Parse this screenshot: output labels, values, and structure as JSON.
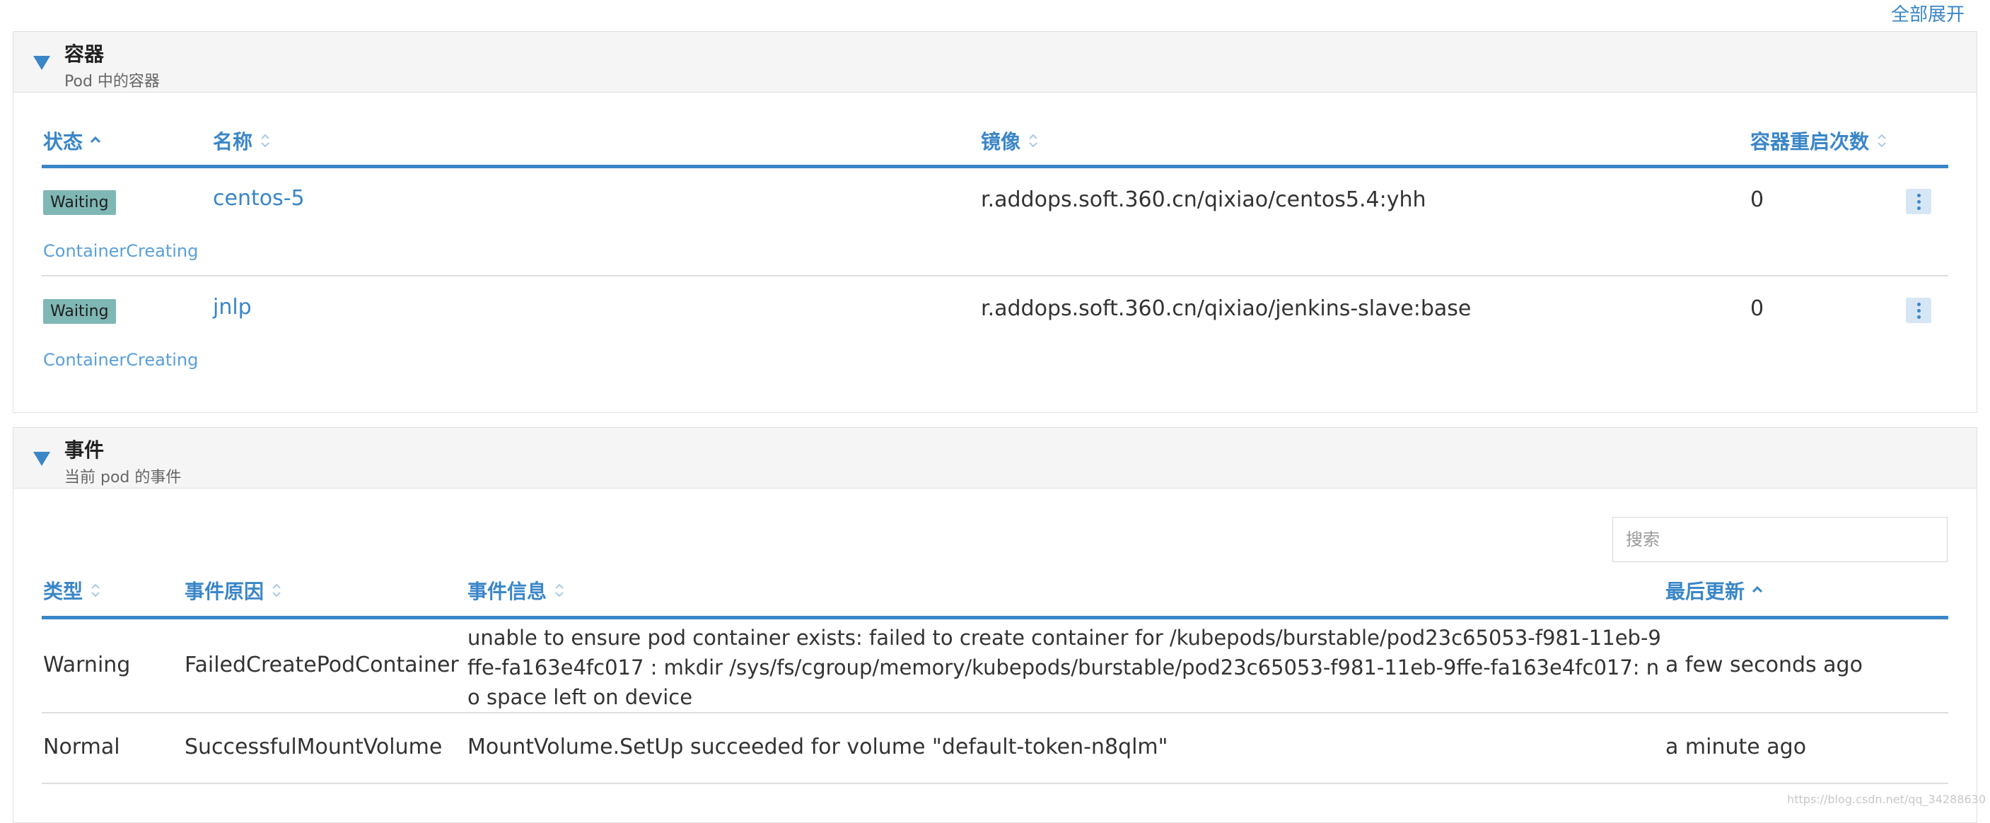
{
  "expand_all": "全部展开",
  "containers": {
    "title": "容器",
    "subtitle": "Pod 中的容器",
    "columns": [
      "状态",
      "名称",
      "镜像",
      "容器重启次数"
    ],
    "rows": [
      {
        "status": "Waiting",
        "reason": "ContainerCreating",
        "name": "centos-5",
        "image": "r.addops.soft.360.cn/qixiao/centos5.4:yhh",
        "restarts": "0"
      },
      {
        "status": "Waiting",
        "reason": "ContainerCreating",
        "name": "jnlp",
        "image": "r.addops.soft.360.cn/qixiao/jenkins-slave:base",
        "restarts": "0"
      }
    ]
  },
  "events": {
    "title": "事件",
    "subtitle": "当前 pod 的事件",
    "search_placeholder": "搜索",
    "columns": [
      "类型",
      "事件原因",
      "事件信息",
      "最后更新"
    ],
    "rows": [
      {
        "type": "Warning",
        "reason": "FailedCreatePodContainer",
        "message": "unable to ensure pod container exists: failed to create container for /kubepods/burstable/pod23c65053-f981-11eb-9ffe-fa163e4fc017 : mkdir /sys/fs/cgroup/memory/kubepods/burstable/pod23c65053-f981-11eb-9ffe-fa163e4fc017: no space left on device",
        "updated": "a few seconds ago"
      },
      {
        "type": "Normal",
        "reason": "SuccessfulMountVolume",
        "message": "MountVolume.SetUp succeeded for volume \"default-token-n8qlm\"",
        "updated": "a minute ago"
      }
    ]
  },
  "watermark": "https://blog.csdn.net/qq_34288630",
  "colors": {
    "accent": "#3a86c8",
    "badge": "#7fb7b5",
    "header_bg": "#f5f5f5"
  }
}
